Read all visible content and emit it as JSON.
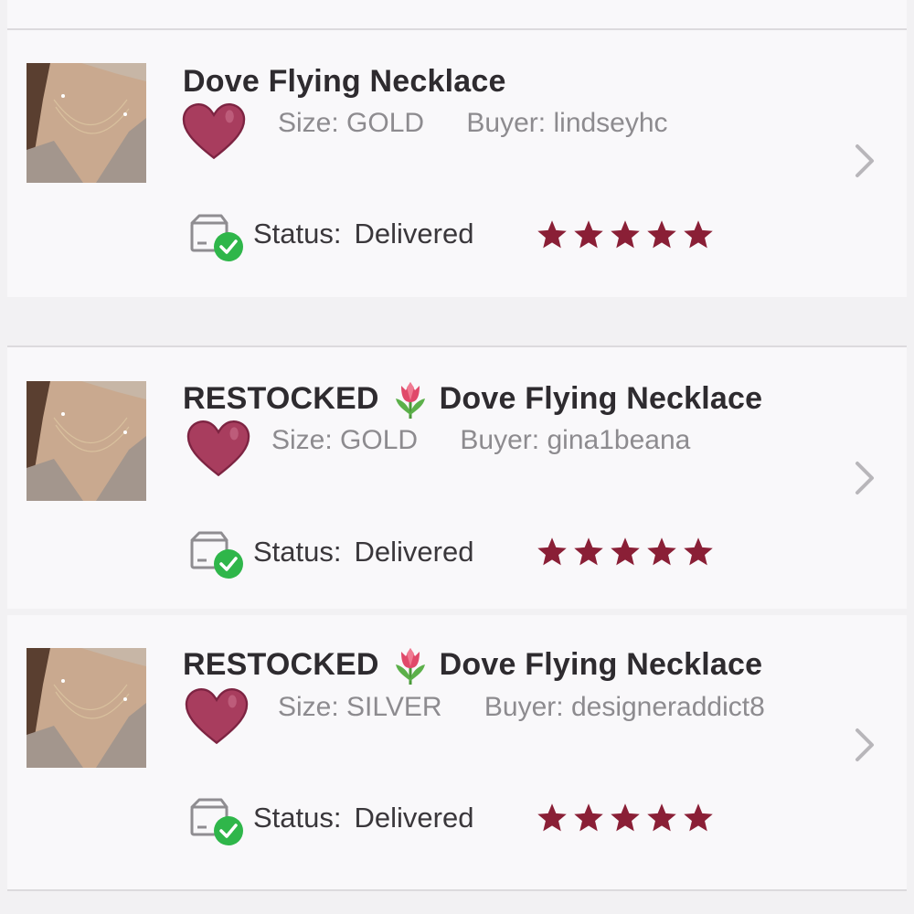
{
  "orders": [
    {
      "title_prefix": "",
      "title_emoji": "",
      "title": "Dove Flying Necklace",
      "size_label": "Size:",
      "size_value": "GOLD",
      "buyer_label": "Buyer:",
      "buyer_value": "lindseyhc",
      "status_label": "Status:",
      "status_value": "Delivered",
      "rating": 5
    },
    {
      "title_prefix": "RESTOCKED",
      "title_emoji": "tulip-icon",
      "title": "Dove Flying Necklace",
      "size_label": "Size:",
      "size_value": "GOLD",
      "buyer_label": "Buyer:",
      "buyer_value": "gina1beana",
      "status_label": "Status:",
      "status_value": "Delivered",
      "rating": 5
    },
    {
      "title_prefix": "RESTOCKED",
      "title_emoji": "tulip-icon",
      "title": "Dove Flying Necklace",
      "size_label": "Size:",
      "size_value": "SILVER",
      "buyer_label": "Buyer:",
      "buyer_value": "designeraddict8",
      "status_label": "Status:",
      "status_value": "Delivered",
      "rating": 5
    }
  ],
  "colors": {
    "star": "#8a1f36",
    "heart": "#a83d5e",
    "check": "#2fb64a",
    "chevron": "#b8b6ba",
    "title": "#2e2b2f",
    "meta": "#8d8b8f"
  }
}
